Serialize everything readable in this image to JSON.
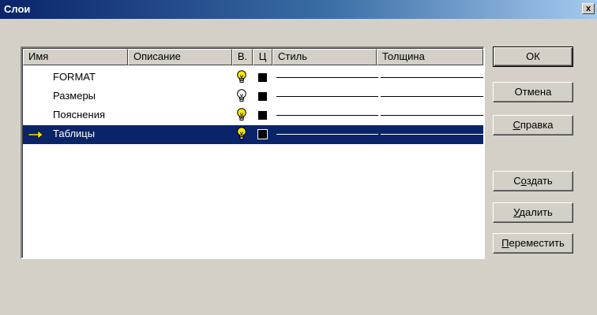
{
  "window": {
    "title": "Слои",
    "close_glyph": "x"
  },
  "columns": {
    "name": "Имя",
    "description": "Описание",
    "visible": "В.",
    "color": "Ц",
    "style": "Стиль",
    "thickness": "Толщина"
  },
  "layers": [
    {
      "name": "FORMAT",
      "bulb_on": true,
      "current": false,
      "selected": false,
      "color": "#000000"
    },
    {
      "name": "Размеры",
      "bulb_on": false,
      "current": false,
      "selected": false,
      "color": "#000000"
    },
    {
      "name": "Пояснения",
      "bulb_on": true,
      "current": false,
      "selected": false,
      "color": "#000000"
    },
    {
      "name": "Таблицы",
      "bulb_on": true,
      "current": true,
      "selected": true,
      "color": "#000000"
    }
  ],
  "buttons": {
    "ok": "ОК",
    "cancel": "Отмена",
    "help": {
      "mnemonic": "С",
      "rest": "правка"
    },
    "create": {
      "pre": "С",
      "mnemonic": "о",
      "rest": "здать"
    },
    "delete": {
      "mnemonic": "У",
      "rest": "далить"
    },
    "move": {
      "mnemonic": "П",
      "rest": "ереместить"
    }
  },
  "colors": {
    "selection": "#0a246a",
    "bulb_on": "#ffe800",
    "bulb_off": "#ffffff",
    "current_arrow": "#ffe800"
  }
}
